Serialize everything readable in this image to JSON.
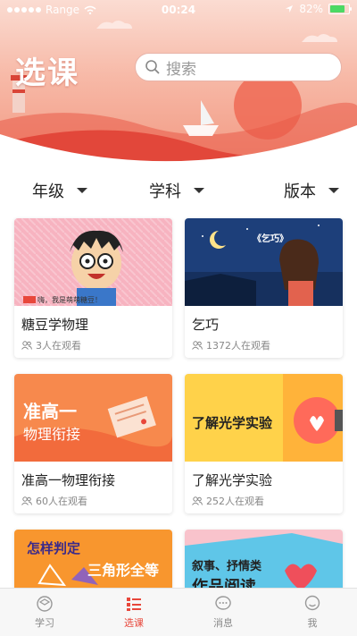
{
  "status_bar": {
    "carrier": "Range",
    "time": "00:24",
    "battery": "82%",
    "battery_level": 0.82
  },
  "header": {
    "title": "选课",
    "search_placeholder": "搜索"
  },
  "filters": [
    {
      "label": "年级",
      "icon": "chevron-down-icon"
    },
    {
      "label": "学科",
      "icon": "chevron-down-icon"
    },
    {
      "label": "版本",
      "icon": "chevron-down-icon"
    }
  ],
  "courses": [
    {
      "title": "糖豆学物理",
      "viewers": "3人在观看",
      "thumb_caption": "嗨，我是萌萌糖豆！"
    },
    {
      "title": "乞巧",
      "viewers": "1372人在观看",
      "thumb_caption": "《乞巧》"
    },
    {
      "title": "准高一物理衔接",
      "viewers": "60人在观看",
      "thumb_line1": "准高一",
      "thumb_line2": "物理衔接"
    },
    {
      "title": "了解光学实验",
      "viewers": "252人在观看",
      "thumb_text": "了解光学实验"
    },
    {
      "thumb_line1": "怎样判定",
      "thumb_line2": "三角形全等"
    },
    {
      "thumb_line1": "叙事、抒情类",
      "thumb_line2": "作品阅读"
    }
  ],
  "bottom_nav": [
    {
      "label": "学习",
      "icon": "study-icon",
      "active": false
    },
    {
      "label": "选课",
      "icon": "course-list-icon",
      "active": true
    },
    {
      "label": "消息",
      "icon": "message-icon",
      "active": false
    },
    {
      "label": "我",
      "icon": "profile-icon",
      "active": false
    }
  ],
  "colors": {
    "accent": "#e8473b",
    "header_top": "#fbdcd2",
    "header_bottom": "#f19780"
  }
}
